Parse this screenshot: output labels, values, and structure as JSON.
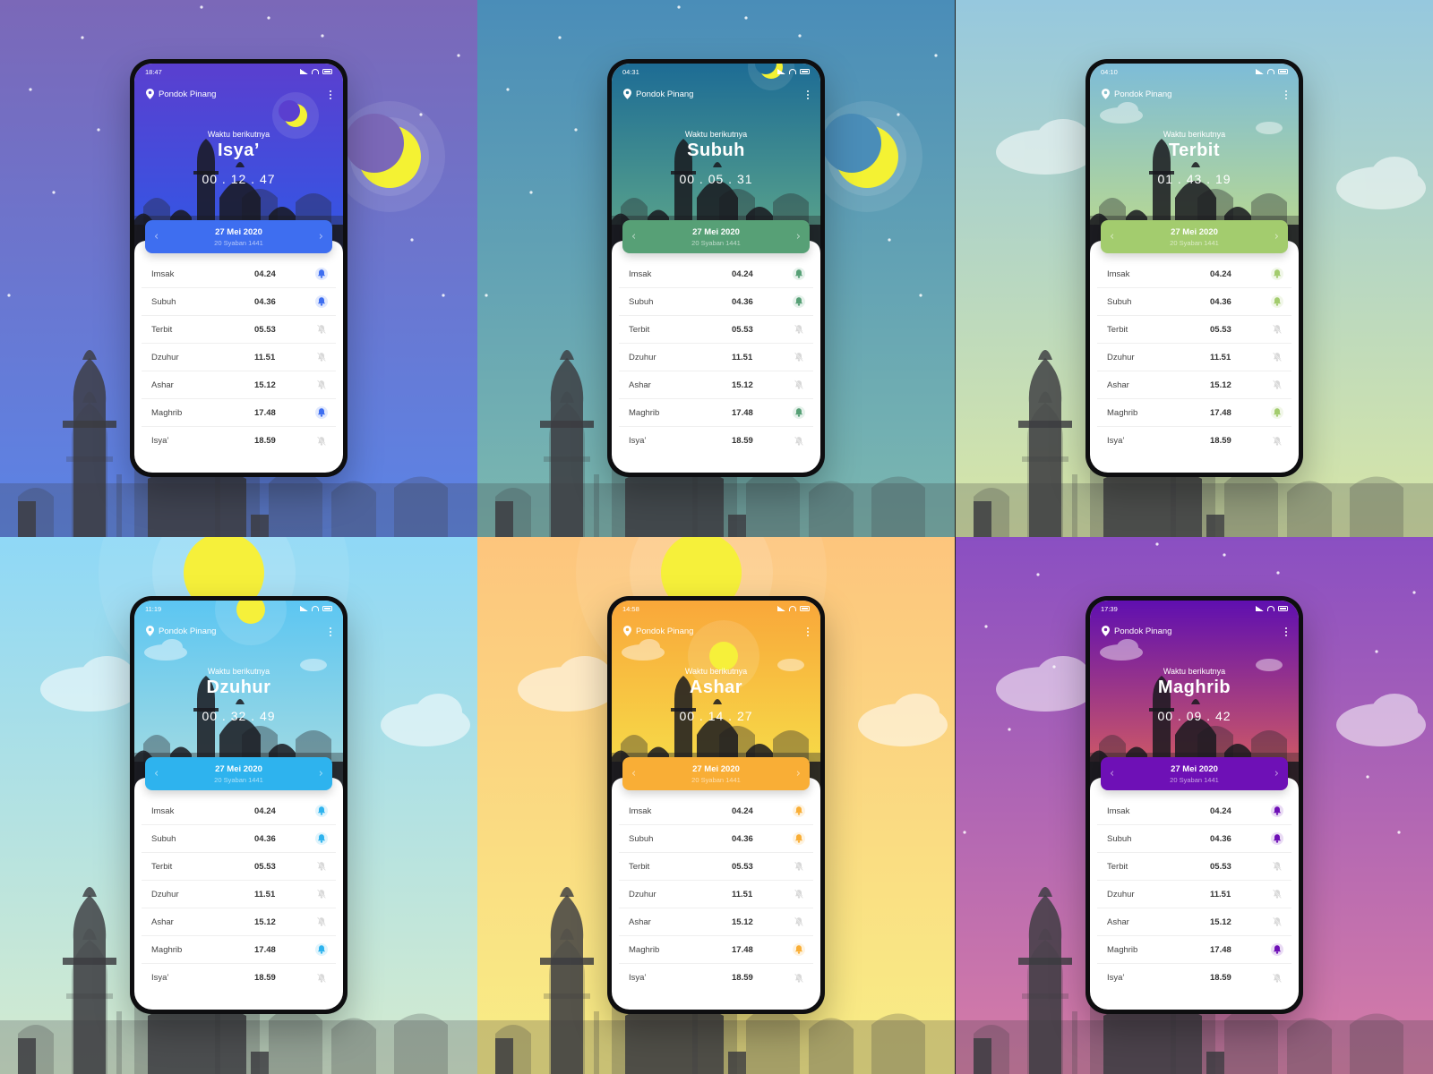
{
  "common": {
    "location": "Pondok Pinang",
    "next_label": "Waktu berikutnya",
    "date": "27 Mei 2020",
    "hijri": "20 Syaban 1441"
  },
  "tiles": [
    {
      "id": "isya",
      "time": "18:47",
      "next": "Isya’",
      "countdown": "00 . 12 . 47",
      "accent": "#3e6ef0",
      "bg_top": "#7b68b8",
      "bg_bottom": "#5b84e6",
      "hero_top": "#5a3fcf",
      "hero_bottom": "#3058e6",
      "moon": true,
      "stars": true,
      "clouds": false,
      "sun": false,
      "prayers": [
        {
          "name": "Imsak",
          "time": "04.24",
          "alarm": true
        },
        {
          "name": "Subuh",
          "time": "04.36",
          "alarm": true
        },
        {
          "name": "Terbit",
          "time": "05.53",
          "alarm": false
        },
        {
          "name": "Dzuhur",
          "time": "11.51",
          "alarm": false
        },
        {
          "name": "Ashar",
          "time": "15.12",
          "alarm": false
        },
        {
          "name": "Maghrib",
          "time": "17.48",
          "alarm": true
        },
        {
          "name": "Isya’",
          "time": "18.59",
          "alarm": false
        }
      ]
    },
    {
      "id": "subuh",
      "time": "04:31",
      "next": "Subuh",
      "countdown": "00 . 05 . 31",
      "accent": "#57a076",
      "bg_top": "#4a8db8",
      "bg_bottom": "#7cb8b0",
      "hero_top": "#1d6c95",
      "hero_bottom": "#5fa88a",
      "moon": true,
      "stars": true,
      "clouds": false,
      "sun": false,
      "prayers": [
        {
          "name": "Imsak",
          "time": "04.24",
          "alarm": true
        },
        {
          "name": "Subuh",
          "time": "04.36",
          "alarm": true
        },
        {
          "name": "Terbit",
          "time": "05.53",
          "alarm": false
        },
        {
          "name": "Dzuhur",
          "time": "11.51",
          "alarm": false
        },
        {
          "name": "Ashar",
          "time": "15.12",
          "alarm": false
        },
        {
          "name": "Maghrib",
          "time": "17.48",
          "alarm": true
        },
        {
          "name": "Isya’",
          "time": "18.59",
          "alarm": false
        }
      ]
    },
    {
      "id": "terbit",
      "time": "04:10",
      "next": "Terbit",
      "countdown": "01 . 43 . 19",
      "accent": "#a3cc6e",
      "bg_top": "#96c8de",
      "bg_bottom": "#d8e6a6",
      "hero_top": "#7dbcd8",
      "hero_bottom": "#bfdb8a",
      "moon": false,
      "stars": false,
      "clouds": true,
      "sun": false,
      "prayers": [
        {
          "name": "Imsak",
          "time": "04.24",
          "alarm": true
        },
        {
          "name": "Subuh",
          "time": "04.36",
          "alarm": true
        },
        {
          "name": "Terbit",
          "time": "05.53",
          "alarm": false
        },
        {
          "name": "Dzuhur",
          "time": "11.51",
          "alarm": false
        },
        {
          "name": "Ashar",
          "time": "15.12",
          "alarm": false
        },
        {
          "name": "Maghrib",
          "time": "17.48",
          "alarm": true
        },
        {
          "name": "Isya’",
          "time": "18.59",
          "alarm": false
        }
      ]
    },
    {
      "id": "dzuhur",
      "time": "11:19",
      "next": "Dzuhur",
      "countdown": "00 . 32 . 49",
      "accent": "#2eb3ee",
      "bg_top": "#8fd8f6",
      "bg_bottom": "#d5ebcf",
      "hero_top": "#5cc6f2",
      "hero_bottom": "#a9dce0",
      "moon": false,
      "stars": false,
      "clouds": true,
      "sun": true,
      "prayers": [
        {
          "name": "Imsak",
          "time": "04.24",
          "alarm": true
        },
        {
          "name": "Subuh",
          "time": "04.36",
          "alarm": true
        },
        {
          "name": "Terbit",
          "time": "05.53",
          "alarm": false
        },
        {
          "name": "Dzuhur",
          "time": "11.51",
          "alarm": false
        },
        {
          "name": "Ashar",
          "time": "15.12",
          "alarm": false
        },
        {
          "name": "Maghrib",
          "time": "17.48",
          "alarm": true
        },
        {
          "name": "Isya’",
          "time": "18.59",
          "alarm": false
        }
      ]
    },
    {
      "id": "ashar",
      "time": "14:58",
      "next": "Ashar",
      "countdown": "00 . 14 . 27",
      "accent": "#f9ae36",
      "bg_top": "#fdc57d",
      "bg_bottom": "#f8ee86",
      "hero_top": "#f9a73a",
      "hero_bottom": "#f6e24a",
      "moon": false,
      "stars": false,
      "clouds": true,
      "sun": true,
      "prayers": [
        {
          "name": "Imsak",
          "time": "04.24",
          "alarm": true
        },
        {
          "name": "Subuh",
          "time": "04.36",
          "alarm": true
        },
        {
          "name": "Terbit",
          "time": "05.53",
          "alarm": false
        },
        {
          "name": "Dzuhur",
          "time": "11.51",
          "alarm": false
        },
        {
          "name": "Ashar",
          "time": "15.12",
          "alarm": false
        },
        {
          "name": "Maghrib",
          "time": "17.48",
          "alarm": true
        },
        {
          "name": "Isya’",
          "time": "18.59",
          "alarm": false
        }
      ]
    },
    {
      "id": "maghrib",
      "time": "17:39",
      "next": "Maghrib",
      "countdown": "00 . 09 . 42",
      "accent": "#6e10b6",
      "bg_top": "#8a4fc2",
      "bg_bottom": "#d77da6",
      "hero_top": "#5f0fb0",
      "hero_bottom": "#e0645a",
      "moon": false,
      "stars": true,
      "clouds": true,
      "sun": false,
      "prayers": [
        {
          "name": "Imsak",
          "time": "04.24",
          "alarm": true
        },
        {
          "name": "Subuh",
          "time": "04.36",
          "alarm": true
        },
        {
          "name": "Terbit",
          "time": "05.53",
          "alarm": false
        },
        {
          "name": "Dzuhur",
          "time": "11.51",
          "alarm": false
        },
        {
          "name": "Ashar",
          "time": "15.12",
          "alarm": false
        },
        {
          "name": "Maghrib",
          "time": "17.48",
          "alarm": true
        },
        {
          "name": "Isya’",
          "time": "18.59",
          "alarm": false
        }
      ]
    }
  ]
}
